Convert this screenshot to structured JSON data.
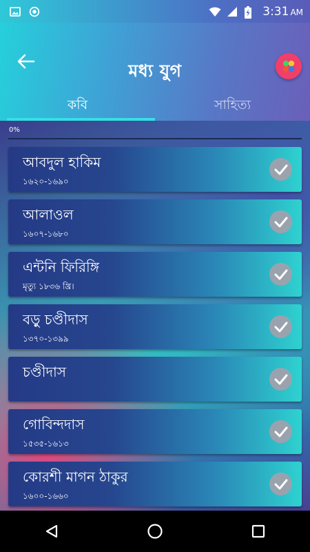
{
  "status_bar": {
    "time": "3:31",
    "ampm": "AM",
    "icons": [
      "gallery-icon",
      "record-icon",
      "wifi-icon",
      "signal-icon",
      "battery-charging-icon"
    ]
  },
  "header": {
    "title": "মধ্য যুগ",
    "back_icon": "arrow-left-icon",
    "menu_icon": "color-dots-icon",
    "accent": "#ef3f6a"
  },
  "tabs": [
    {
      "label": "কবি",
      "active": true
    },
    {
      "label": "সাহিত্য",
      "active": false
    }
  ],
  "progress": {
    "label": "0%",
    "value": 0
  },
  "items": [
    {
      "name": "আবদুল হাকিম",
      "years": "১৬২০-১৬৯০"
    },
    {
      "name": "আলাওল",
      "years": "১৬০৭-১৬৮০"
    },
    {
      "name": "এন্টনি ফিরিঙ্গি",
      "years": "মৃত্যু ১৮৩৬ খ্রি।"
    },
    {
      "name": "বড়ু চণ্ডীদাস",
      "years": "১৩৭০-১৩৯৯"
    },
    {
      "name": "চণ্ডীদাস",
      "years": ""
    },
    {
      "name": "গোবিন্দদাস",
      "years": "১৫৩৫-১৬১৩"
    },
    {
      "name": "কোরশী মাগন ঠাকুর",
      "years": "১৬০০-১৬৬০"
    }
  ],
  "nav": [
    "back-triangle-icon",
    "home-circle-icon",
    "recents-square-icon"
  ]
}
